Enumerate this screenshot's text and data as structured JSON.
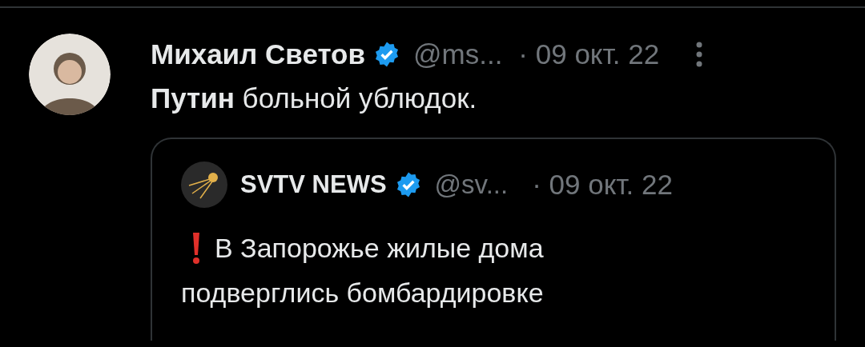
{
  "tweet": {
    "author_name": "Михаил Светов",
    "verified": true,
    "handle": "@ms...",
    "timestamp": "· 09 окт. 22",
    "text": "**Путин** больной ублюдок.",
    "quoted_tweet": {
      "author_name": "SVTV NEWS",
      "verified": true,
      "handle": "@sv...",
      "timestamp": "· 09 окт. 22",
      "text_lines": [
        "В Запорожье жилые дома",
        "подверглись бомбардировке"
      ]
    }
  }
}
